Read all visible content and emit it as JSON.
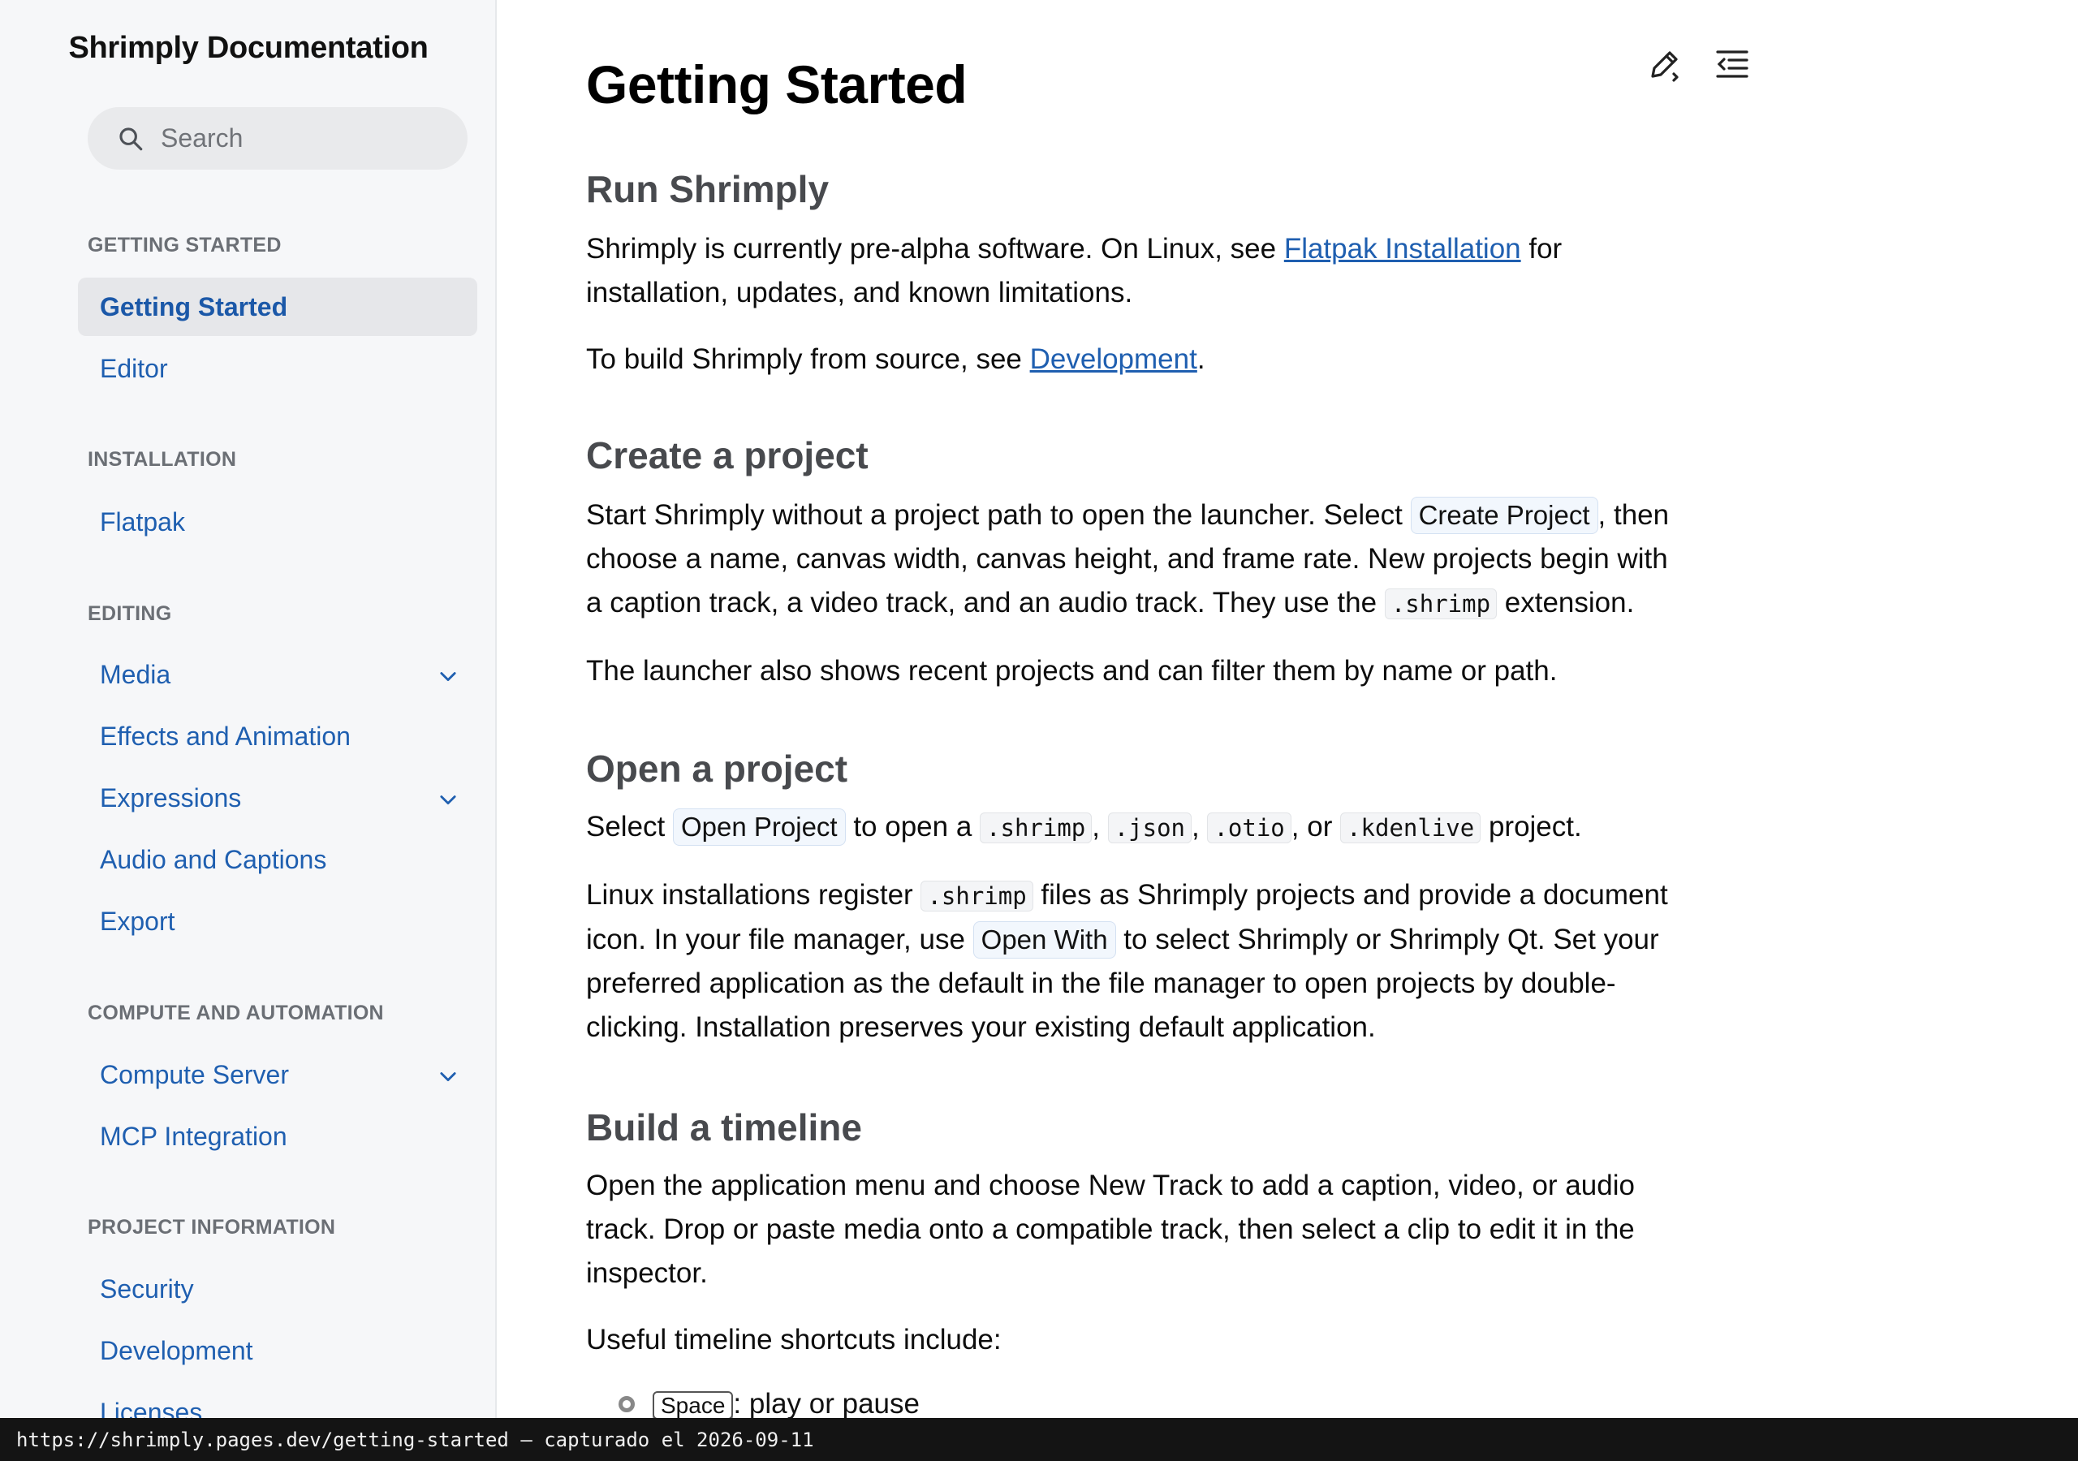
{
  "sidebar": {
    "title": "Shrimply Documentation",
    "search_placeholder": "Search",
    "sections": [
      {
        "label": "GETTING STARTED",
        "items": [
          {
            "label": "Getting Started"
          },
          {
            "label": "Editor"
          }
        ]
      },
      {
        "label": "INSTALLATION",
        "items": [
          {
            "label": "Flatpak"
          }
        ]
      },
      {
        "label": "EDITING",
        "items": [
          {
            "label": "Media"
          },
          {
            "label": "Effects and Animation"
          },
          {
            "label": "Expressions"
          },
          {
            "label": "Audio and Captions"
          },
          {
            "label": "Export"
          }
        ]
      },
      {
        "label": "COMPUTE AND AUTOMATION",
        "items": [
          {
            "label": "Compute Server"
          },
          {
            "label": "MCP Integration"
          }
        ]
      },
      {
        "label": "PROJECT INFORMATION",
        "items": [
          {
            "label": "Security"
          },
          {
            "label": "Development"
          },
          {
            "label": "Licenses"
          }
        ]
      }
    ],
    "active_item": "Getting Started"
  },
  "page": {
    "title": "Getting Started",
    "icons": [
      "edit-page-icon",
      "table-of-contents-icon"
    ],
    "run": {
      "heading": "Run Shrimply",
      "p1_before": "Shrimply is currently pre-alpha software. On Linux, see ",
      "p1_link": "Flatpak Installation",
      "p1_after": " for",
      "p1_line2": "installation, updates, and known limitations.",
      "p2_before": "To build Shrimply from source, see ",
      "p2_link": "Development",
      "p2_after": "."
    },
    "create": {
      "heading": "Create a project",
      "l1_before": "Start Shrimply without a project path to open the launcher. Select ",
      "l1_chip": "Create Project",
      "l1_after": ", then",
      "l2": "choose a name, canvas width, canvas height, and frame rate. New projects begin with",
      "l3_before": "a caption track, a video track, and an audio track. They use the ",
      "l3_code": ".shrimp",
      "l3_after": " extension.",
      "p2": "The launcher also shows recent projects and can filter them by name or path."
    },
    "open": {
      "heading": "Open a project",
      "p1_before": "Select ",
      "p1_chip": "Open Project",
      "p1_mid": " to open a ",
      "codes": [
        ".shrimp",
        ".json",
        ".otio",
        ".kdenlive"
      ],
      "p1_or": ", or ",
      "p1_after": " project.",
      "l1_before": "Linux installations register ",
      "l1_code": ".shrimp",
      "l1_after": " files as Shrimply projects and provide a document",
      "l2_before": "icon. In your file manager, use ",
      "l2_chip": "Open With",
      "l2_after": " to select Shrimply or Shrimply Qt. Set your",
      "l3": "preferred application as the default in the file manager to open projects by double-",
      "l4": "clicking. Installation preserves your existing default application."
    },
    "timeline": {
      "heading": "Build a timeline",
      "l1": "Open the application menu and choose New Track to add a caption, video, or audio",
      "l2": "track. Drop or paste media onto a compatible track, then select a clip to edit it in the",
      "l3": "inspector.",
      "p2": "Useful timeline shortcuts include:",
      "shortcut_key": "Space",
      "shortcut_desc": ": play or pause"
    }
  },
  "status_bar": {
    "text": "https://shrimply.pages.dev/getting-started — capturado el 2026-09-11"
  }
}
